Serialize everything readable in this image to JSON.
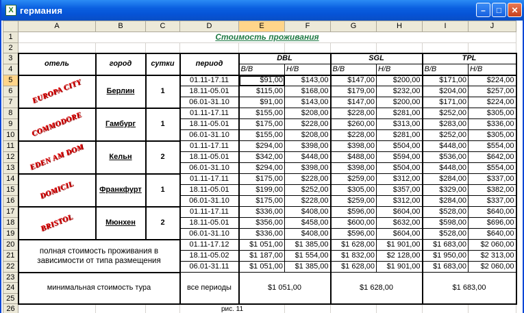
{
  "window": {
    "title": "германия"
  },
  "columns": [
    "A",
    "B",
    "C",
    "D",
    "E",
    "F",
    "G",
    "H",
    "I",
    "J"
  ],
  "selected_column": "E",
  "selected_row": 5,
  "rows": [
    "1",
    "2",
    "3",
    "4",
    "5",
    "6",
    "7",
    "8",
    "9",
    "10",
    "11",
    "12",
    "13",
    "14",
    "15",
    "16",
    "17",
    "18",
    "19",
    "20",
    "21",
    "22",
    "23",
    "24",
    "25",
    "26"
  ],
  "sheet": {
    "title": "Стоимость проживания",
    "headers": {
      "hotel": "отель",
      "city": "город",
      "days": "сутки",
      "period": "период",
      "dbl": "DBL",
      "sgl": "SGL",
      "tpl": "TPL",
      "bb": "B/B",
      "hb": "H/B"
    },
    "hotels": [
      {
        "name": "EUROPA CITY",
        "city": "Берлин",
        "days": "1",
        "rows": [
          {
            "period": "01.11-17.11",
            "dbl_bb": "$91,00",
            "dbl_hb": "$143,00",
            "sgl_bb": "$147,00",
            "sgl_hb": "$200,00",
            "tpl_bb": "$171,00",
            "tpl_hb": "$224,00"
          },
          {
            "period": "18.11-05.01",
            "dbl_bb": "$115,00",
            "dbl_hb": "$168,00",
            "sgl_bb": "$179,00",
            "sgl_hb": "$232,00",
            "tpl_bb": "$204,00",
            "tpl_hb": "$257,00"
          },
          {
            "period": "06.01-31.10",
            "dbl_bb": "$91,00",
            "dbl_hb": "$143,00",
            "sgl_bb": "$147,00",
            "sgl_hb": "$200,00",
            "tpl_bb": "$171,00",
            "tpl_hb": "$224,00"
          }
        ]
      },
      {
        "name": "COMMODORE",
        "city": "Гамбург",
        "days": "1",
        "rows": [
          {
            "period": "01.11-17.11",
            "dbl_bb": "$155,00",
            "dbl_hb": "$208,00",
            "sgl_bb": "$228,00",
            "sgl_hb": "$281,00",
            "tpl_bb": "$252,00",
            "tpl_hb": "$305,00"
          },
          {
            "period": "18.11-05.01",
            "dbl_bb": "$175,00",
            "dbl_hb": "$228,00",
            "sgl_bb": "$260,00",
            "sgl_hb": "$313,00",
            "tpl_bb": "$283,00",
            "tpl_hb": "$336,00"
          },
          {
            "period": "06.01-31.10",
            "dbl_bb": "$155,00",
            "dbl_hb": "$208,00",
            "sgl_bb": "$228,00",
            "sgl_hb": "$281,00",
            "tpl_bb": "$252,00",
            "tpl_hb": "$305,00"
          }
        ]
      },
      {
        "name": "EDEN AM DOM",
        "city": "Кельн",
        "days": "2",
        "rows": [
          {
            "period": "01.11-17.11",
            "dbl_bb": "$294,00",
            "dbl_hb": "$398,00",
            "sgl_bb": "$398,00",
            "sgl_hb": "$504,00",
            "tpl_bb": "$448,00",
            "tpl_hb": "$554,00"
          },
          {
            "period": "18.11-05.01",
            "dbl_bb": "$342,00",
            "dbl_hb": "$448,00",
            "sgl_bb": "$488,00",
            "sgl_hb": "$594,00",
            "tpl_bb": "$536,00",
            "tpl_hb": "$642,00"
          },
          {
            "period": "06.01-31.10",
            "dbl_bb": "$294,00",
            "dbl_hb": "$398,00",
            "sgl_bb": "$398,00",
            "sgl_hb": "$504,00",
            "tpl_bb": "$448,00",
            "tpl_hb": "$554,00"
          }
        ]
      },
      {
        "name": "DOMICIL",
        "city": "Франкфурт",
        "days": "1",
        "rows": [
          {
            "period": "01.11-17.11",
            "dbl_bb": "$175,00",
            "dbl_hb": "$228,00",
            "sgl_bb": "$259,00",
            "sgl_hb": "$312,00",
            "tpl_bb": "$284,00",
            "tpl_hb": "$337,00"
          },
          {
            "period": "18.11-05.01",
            "dbl_bb": "$199,00",
            "dbl_hb": "$252,00",
            "sgl_bb": "$305,00",
            "sgl_hb": "$357,00",
            "tpl_bb": "$329,00",
            "tpl_hb": "$382,00"
          },
          {
            "period": "06.01-31.10",
            "dbl_bb": "$175,00",
            "dbl_hb": "$228,00",
            "sgl_bb": "$259,00",
            "sgl_hb": "$312,00",
            "tpl_bb": "$284,00",
            "tpl_hb": "$337,00"
          }
        ]
      },
      {
        "name": "BRISTOL",
        "city": "Мюнхен",
        "days": "2",
        "rows": [
          {
            "period": "01.11-17.11",
            "dbl_bb": "$336,00",
            "dbl_hb": "$408,00",
            "sgl_bb": "$596,00",
            "sgl_hb": "$604,00",
            "tpl_bb": "$528,00",
            "tpl_hb": "$640,00"
          },
          {
            "period": "18.11-05.01",
            "dbl_bb": "$356,00",
            "dbl_hb": "$458,00",
            "sgl_bb": "$600,00",
            "sgl_hb": "$632,00",
            "tpl_bb": "$598,00",
            "tpl_hb": "$696,00"
          },
          {
            "period": "06.01-31.10",
            "dbl_bb": "$336,00",
            "dbl_hb": "$408,00",
            "sgl_bb": "$596,00",
            "sgl_hb": "$604,00",
            "tpl_bb": "$528,00",
            "tpl_hb": "$640,00"
          }
        ]
      }
    ],
    "total": {
      "label": "полная стоимость проживания в зависимости от типа размещения",
      "rows": [
        {
          "period": "01.11-17.12",
          "dbl_bb": "$1 051,00",
          "dbl_hb": "$1 385,00",
          "sgl_bb": "$1 628,00",
          "sgl_hb": "$1 901,00",
          "tpl_bb": "$1 683,00",
          "tpl_hb": "$2 060,00"
        },
        {
          "period": "18.11-05.02",
          "dbl_bb": "$1 187,00",
          "dbl_hb": "$1 554,00",
          "sgl_bb": "$1 832,00",
          "sgl_hb": "$2 128,00",
          "tpl_bb": "$1 950,00",
          "tpl_hb": "$2 313,00"
        },
        {
          "period": "06.01-31.11",
          "dbl_bb": "$1 051,00",
          "dbl_hb": "$1 385,00",
          "sgl_bb": "$1 628,00",
          "sgl_hb": "$1 901,00",
          "tpl_bb": "$1 683,00",
          "tpl_hb": "$2 060,00"
        }
      ]
    },
    "minimum": {
      "label": "минимальная стоимость тура",
      "period": "все периоды",
      "dbl": "$1 051,00",
      "sgl": "$1 628,00",
      "tpl": "$1 683,00"
    },
    "caption": "рис. 11"
  }
}
